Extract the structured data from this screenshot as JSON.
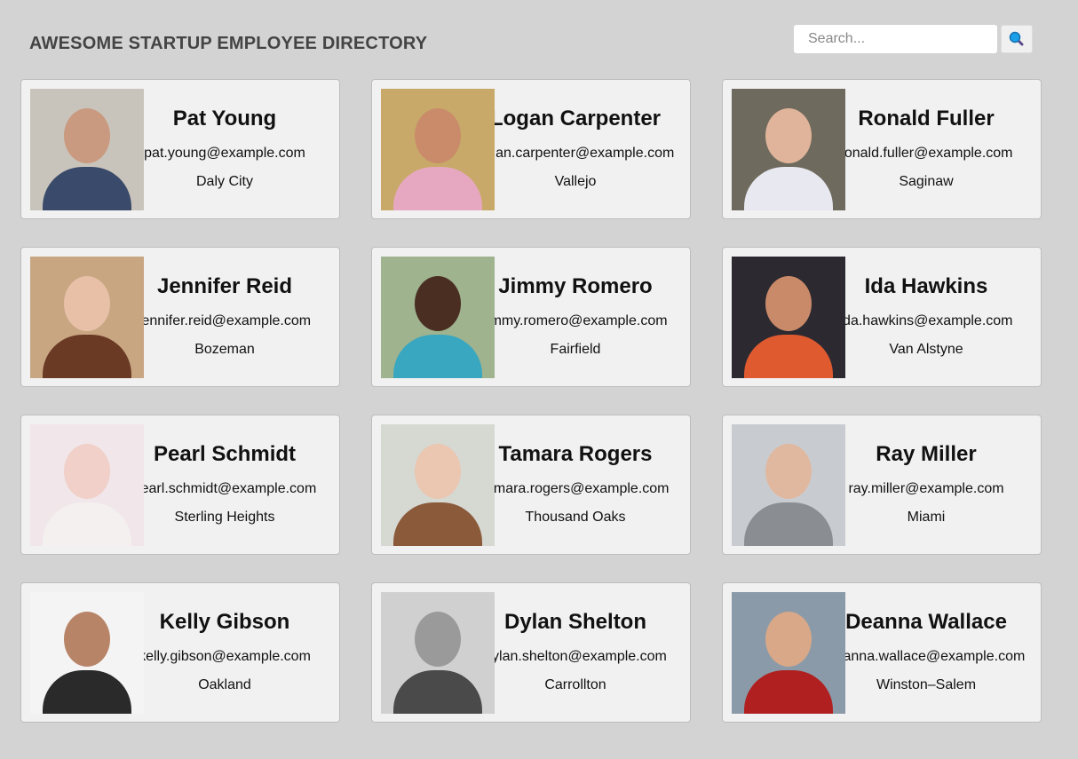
{
  "header": {
    "title": "AWESOME STARTUP EMPLOYEE DIRECTORY",
    "search_placeholder": "Search...",
    "search_icon": "magnifier-icon"
  },
  "employees": [
    {
      "name": "Pat Young",
      "email": "pat.young@example.com",
      "city": "Daly City",
      "bg": "#c9c4bb",
      "skin": "#c99a80",
      "shirt": "#3a4a6a"
    },
    {
      "name": "Logan Carpenter",
      "email": "logan.carpenter@example.com",
      "city": "Vallejo",
      "bg": "#c8a96a",
      "skin": "#c98b6a",
      "shirt": "#e6a8c0"
    },
    {
      "name": "Ronald Fuller",
      "email": "ronald.fuller@example.com",
      "city": "Saginaw",
      "bg": "#6f6a5e",
      "skin": "#e0b49a",
      "shirt": "#e8e8f0"
    },
    {
      "name": "Jennifer Reid",
      "email": "jennifer.reid@example.com",
      "city": "Bozeman",
      "bg": "#c8a682",
      "skin": "#e8c0a8",
      "shirt": "#6b3a25"
    },
    {
      "name": "Jimmy Romero",
      "email": "jimmy.romero@example.com",
      "city": "Fairfield",
      "bg": "#9fb38f",
      "skin": "#4a2e22",
      "shirt": "#3aa7c0"
    },
    {
      "name": "Ida Hawkins",
      "email": "ida.hawkins@example.com",
      "city": "Van Alstyne",
      "bg": "#2c2a30",
      "skin": "#c98a6a",
      "shirt": "#e05a30"
    },
    {
      "name": "Pearl Schmidt",
      "email": "pearl.schmidt@example.com",
      "city": "Sterling Heights",
      "bg": "#f1e6ea",
      "skin": "#f0d0c8",
      "shirt": "#f4f0f0"
    },
    {
      "name": "Tamara Rogers",
      "email": "tamara.rogers@example.com",
      "city": "Thousand Oaks",
      "bg": "#d6d8d2",
      "skin": "#ebc6b0",
      "shirt": "#8a5a3a"
    },
    {
      "name": "Ray Miller",
      "email": "ray.miller@example.com",
      "city": "Miami",
      "bg": "#c8ccd0",
      "skin": "#e0b8a0",
      "shirt": "#8a8e92"
    },
    {
      "name": "Kelly Gibson",
      "email": "kelly.gibson@example.com",
      "city": "Oakland",
      "bg": "#f4f4f4",
      "skin": "#b88468",
      "shirt": "#2a2a2a"
    },
    {
      "name": "Dylan Shelton",
      "email": "dylan.shelton@example.com",
      "city": "Carrollton",
      "bg": "#d0d0d0",
      "skin": "#9a9a9a",
      "shirt": "#4a4a4a"
    },
    {
      "name": "Deanna Wallace",
      "email": "deanna.wallace@example.com",
      "city": "Winston–Salem",
      "bg": "#8a9aa8",
      "skin": "#d8a888",
      "shirt": "#b02020"
    }
  ]
}
